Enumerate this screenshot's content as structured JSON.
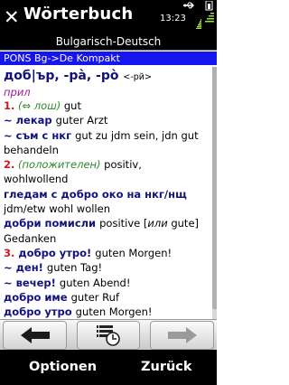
{
  "titlebar": {
    "title": "Wörterbuch",
    "time": "13:23",
    "icons": [
      "close-icon",
      "usb-icon",
      "battery-icon",
      "signal-icon"
    ]
  },
  "subtitle": "Bulgarisch-Deutsch",
  "dictionary_label": "PONS Bg->De Kompakt",
  "entry": {
    "headword": "доб|ър, -рà, -рò",
    "grammar": "<-рй>",
    "pos": "прил",
    "lines": [
      {
        "num": "1.",
        "parts": [
          [
            "gr",
            " (⇔ лош) "
          ],
          [
            "n",
            "gut"
          ]
        ]
      },
      {
        "parts": [
          [
            "bk",
            "~ лекар "
          ],
          [
            "n",
            "guter Arzt"
          ]
        ]
      },
      {
        "parts": [
          [
            "bk",
            "~ съм с нкг "
          ],
          [
            "n",
            "gut zu jdm sein, jdn gut"
          ]
        ]
      },
      {
        "parts": [
          [
            "n",
            "behandeln"
          ]
        ]
      },
      {
        "num": "2.",
        "parts": [
          [
            "gr",
            " (положителен) "
          ],
          [
            "n",
            "positiv,"
          ]
        ]
      },
      {
        "parts": [
          [
            "n",
            "wohlwollend"
          ]
        ]
      },
      {
        "parts": [
          [
            "bk",
            "гледам с добро око на нкг/нщ"
          ]
        ]
      },
      {
        "parts": [
          [
            "n",
            "jdm/etw wohl wollen"
          ]
        ]
      },
      {
        "parts": [
          [
            "bk",
            "добри помисли "
          ],
          [
            "n",
            "positive ["
          ],
          [
            "it",
            "или"
          ],
          [
            "n",
            " gute]"
          ]
        ]
      },
      {
        "parts": [
          [
            "n",
            "Gedanken"
          ]
        ]
      },
      {
        "num": "3.",
        "parts": [
          [
            "bk",
            " добро утро! "
          ],
          [
            "n",
            "guten Morgen!"
          ]
        ]
      },
      {
        "parts": [
          [
            "bk",
            "~ ден! "
          ],
          [
            "n",
            "guten Tag!"
          ]
        ]
      },
      {
        "parts": [
          [
            "bk",
            "~ вечер! "
          ],
          [
            "n",
            "guten Abend!"
          ]
        ]
      },
      {
        "parts": [
          [
            "bk",
            "добро име "
          ],
          [
            "n",
            "guter Ruf"
          ]
        ]
      },
      {
        "parts": [
          [
            "bk",
            "добро утро "
          ],
          [
            "n",
            "guten Morgen!"
          ]
        ]
      }
    ]
  },
  "toolbar": {
    "back_icon": "arrow-left-icon",
    "history_icon": "history-list-icon",
    "forward_icon": "arrow-right-icon"
  },
  "softkeys": {
    "left": "Optionen",
    "right": "Zurück"
  }
}
